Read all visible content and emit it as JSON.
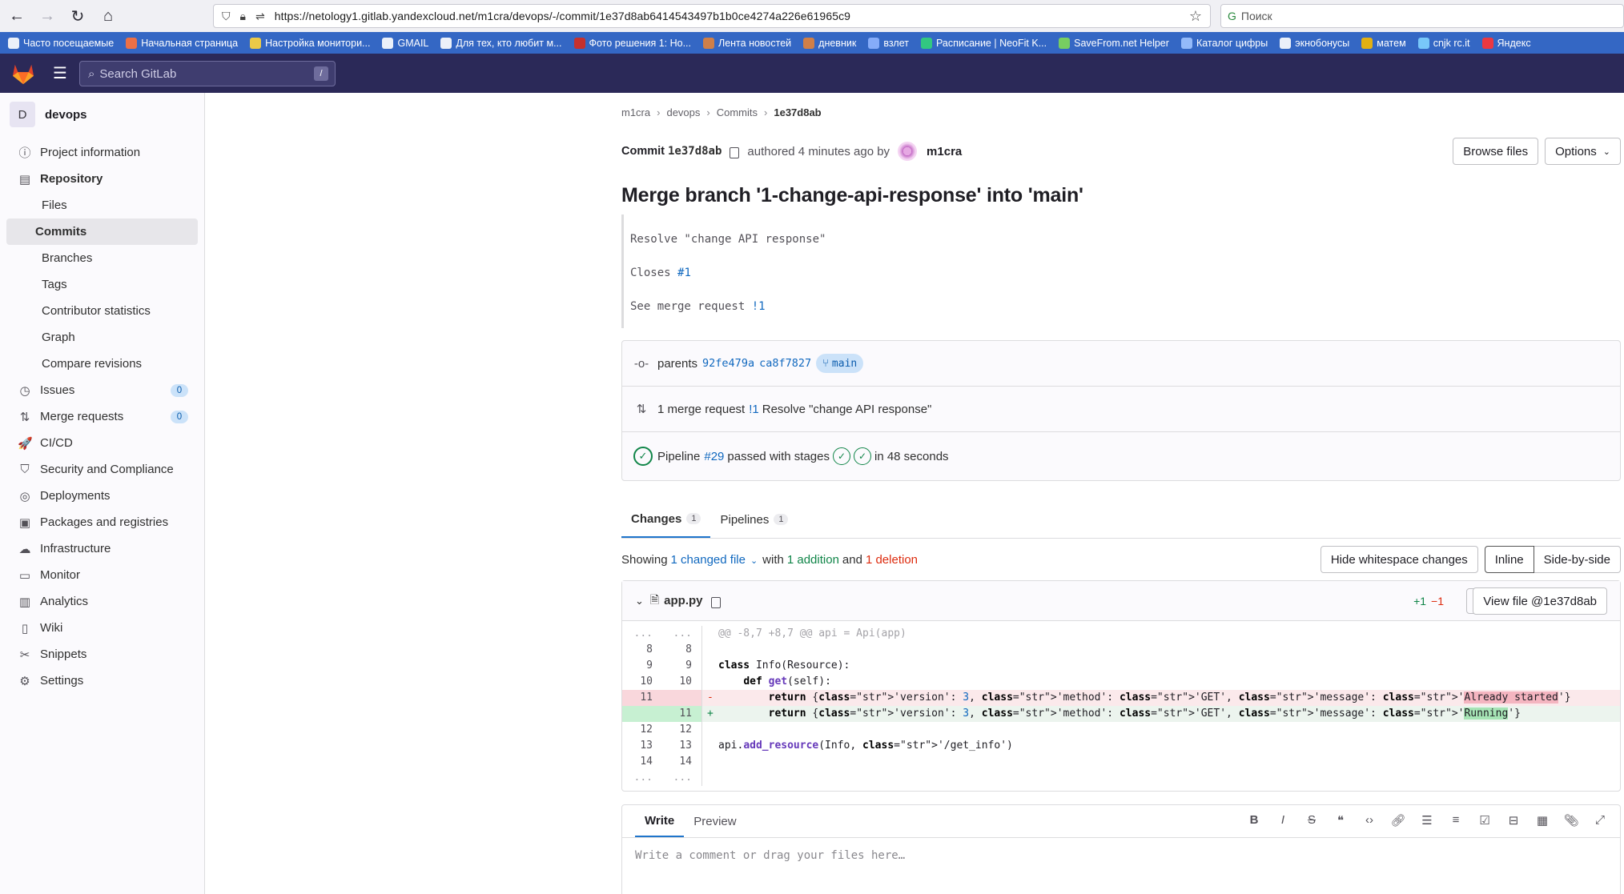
{
  "browser": {
    "url": "https://netology1.gitlab.yandexcloud.net/m1cra/devops/-/commit/1e37d8ab6414543497b1b0ce4274a226e61965c9",
    "search_placeholder": "Поиск",
    "bookmarks": [
      {
        "label": "Часто посещаемые",
        "color": "#ffffff"
      },
      {
        "label": "Начальная страница",
        "color": "#ff7139"
      },
      {
        "label": "Настройка монитори...",
        "color": "#ffd43b"
      },
      {
        "label": "GMAIL",
        "color": "#ffffff"
      },
      {
        "label": "Для тех, кто любит м...",
        "color": "#ffffff"
      },
      {
        "label": "Фото решения 1: Но...",
        "color": "#d52b1e"
      },
      {
        "label": "Лента новостей",
        "color": "#e0823b"
      },
      {
        "label": "дневник",
        "color": "#e0823b"
      },
      {
        "label": "взлет",
        "color": "#8fb4ff"
      },
      {
        "label": "Расписание | NeoFit K...",
        "color": "#32d17a"
      },
      {
        "label": "SaveFrom.net Helper",
        "color": "#7ed957"
      },
      {
        "label": "Каталог цифры",
        "color": "#9ec3ff"
      },
      {
        "label": "экнобонусы",
        "color": "#ffffff"
      },
      {
        "label": "матем",
        "color": "#f5b800"
      },
      {
        "label": "cnjk rc.it",
        "color": "#7fd1ff"
      },
      {
        "label": "Яндекс",
        "color": "#ff3333"
      }
    ]
  },
  "gitlab": {
    "search_placeholder": "Search GitLab",
    "search_shortcut": "/"
  },
  "sidebar": {
    "project_initial": "D",
    "project_name": "devops",
    "items": [
      {
        "label": "Project information",
        "icon": "info-icon",
        "glyph": "ⓘ"
      },
      {
        "label": "Repository",
        "icon": "repository-icon",
        "glyph": "▤",
        "bold": true
      },
      {
        "label": "Files",
        "sub": true
      },
      {
        "label": "Commits",
        "sub": true,
        "active": true
      },
      {
        "label": "Branches",
        "sub": true
      },
      {
        "label": "Tags",
        "sub": true
      },
      {
        "label": "Contributor statistics",
        "sub": true
      },
      {
        "label": "Graph",
        "sub": true
      },
      {
        "label": "Compare revisions",
        "sub": true
      },
      {
        "label": "Issues",
        "icon": "issues-icon",
        "glyph": "◷",
        "count": "0"
      },
      {
        "label": "Merge requests",
        "icon": "merge-request-icon",
        "glyph": "⇅",
        "count": "0"
      },
      {
        "label": "CI/CD",
        "icon": "rocket-icon",
        "glyph": "🚀"
      },
      {
        "label": "Security and Compliance",
        "icon": "shield-icon",
        "glyph": "⛉"
      },
      {
        "label": "Deployments",
        "icon": "deployments-icon",
        "glyph": "◎"
      },
      {
        "label": "Packages and registries",
        "icon": "package-icon",
        "glyph": "▣"
      },
      {
        "label": "Infrastructure",
        "icon": "cloud-icon",
        "glyph": "☁"
      },
      {
        "label": "Monitor",
        "icon": "monitor-icon",
        "glyph": "▭"
      },
      {
        "label": "Analytics",
        "icon": "chart-icon",
        "glyph": "▥"
      },
      {
        "label": "Wiki",
        "icon": "book-icon",
        "glyph": "▯"
      },
      {
        "label": "Snippets",
        "icon": "scissors-icon",
        "glyph": "✂"
      },
      {
        "label": "Settings",
        "icon": "gear-icon",
        "glyph": "⚙"
      }
    ]
  },
  "breadcrumb": [
    "m1cra",
    "devops",
    "Commits",
    "1e37d8ab"
  ],
  "commit": {
    "label": "Commit",
    "short_sha": "1e37d8ab",
    "meta": "authored 4 minutes ago by",
    "author": "m1cra",
    "browse_files": "Browse files",
    "options": "Options",
    "title": "Merge branch '1-change-api-response' into 'main'",
    "desc_line1": "Resolve \"change API response\"",
    "desc_closes": "Closes",
    "desc_closes_ref": "#1",
    "desc_see": "See merge request",
    "desc_mr_ref": "!1"
  },
  "info": {
    "parents_label": "parents",
    "parent1": "92fe479a",
    "parent2": "ca8f7827",
    "branch": "main",
    "mr_prefix": "1 merge request",
    "mr_ref": "!1",
    "mr_title": "Resolve \"change API response\"",
    "pipeline_label": "Pipeline",
    "pipeline_ref": "#29",
    "pipeline_status": "passed with stages",
    "pipeline_duration": "in 48 seconds"
  },
  "tabs": {
    "changes": "Changes",
    "changes_count": "1",
    "pipelines": "Pipelines",
    "pipelines_count": "1"
  },
  "diff_summary": {
    "showing": "Showing",
    "changed_files": "1 changed file",
    "with": "with",
    "additions": "1 addition",
    "and": "and",
    "deletions": "1 deletion",
    "hide_whitespace": "Hide whitespace changes",
    "inline": "Inline",
    "side_by_side": "Side-by-side"
  },
  "file": {
    "name": "app.py",
    "added": "+1",
    "removed": "−1",
    "view_file": "View file @1e37d8ab"
  },
  "diff_lines": [
    {
      "type": "match",
      "old": "...",
      "new": "...",
      "text": "@@ -8,7 +8,7 @@ api = Api(app)"
    },
    {
      "type": "ctx",
      "old": "8",
      "new": "8",
      "text": ""
    },
    {
      "type": "ctx",
      "old": "9",
      "new": "9",
      "text": "class Info(Resource):"
    },
    {
      "type": "ctx",
      "old": "10",
      "new": "10",
      "text": "    def get(self):"
    },
    {
      "type": "del",
      "old": "11",
      "new": "",
      "text": "        return {'version': 3, 'method': 'GET', 'message': 'Already started'}"
    },
    {
      "type": "add",
      "old": "",
      "new": "11",
      "text": "        return {'version': 3, 'method': 'GET', 'message': 'Running'}"
    },
    {
      "type": "ctx",
      "old": "12",
      "new": "12",
      "text": ""
    },
    {
      "type": "ctx",
      "old": "13",
      "new": "13",
      "text": "api.add_resource(Info, '/get_info')"
    },
    {
      "type": "ctx",
      "old": "14",
      "new": "14",
      "text": ""
    },
    {
      "type": "match",
      "old": "...",
      "new": "...",
      "text": ""
    }
  ],
  "editor": {
    "write": "Write",
    "preview": "Preview",
    "placeholder": "Write a comment or drag your files here…"
  },
  "colors": {
    "brand": "#2b2958",
    "link": "#1068bf",
    "success": "#108548",
    "danger": "#dd2b0e"
  }
}
